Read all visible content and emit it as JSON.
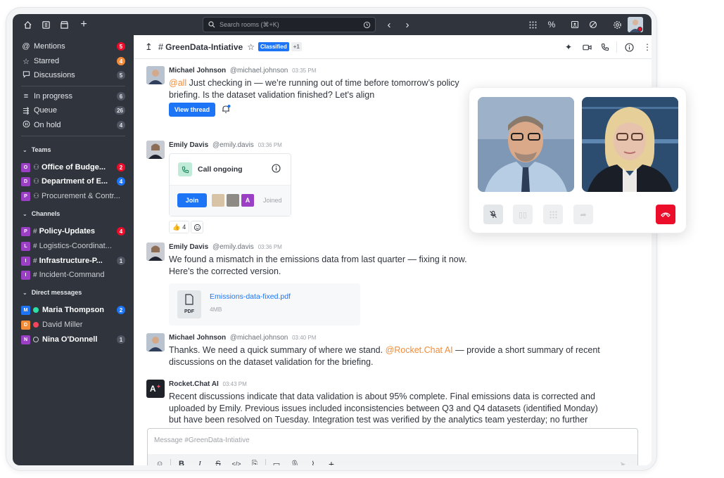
{
  "topbar": {
    "search_placeholder": "Search rooms (⌘+K)",
    "icons": [
      "home-icon",
      "directory-icon",
      "marketplace-icon",
      "plus-icon",
      "history-icon",
      "back-icon",
      "forward-icon",
      "apps-icon",
      "percent-icon",
      "contact-icon",
      "status-icon",
      "settings-icon",
      "user-avatar"
    ]
  },
  "sidebar": {
    "top": [
      {
        "label": "Mentions",
        "badge": "5",
        "badge_color": "#ec0d2a",
        "icon": "at-icon"
      },
      {
        "label": "Starred",
        "badge": "4",
        "badge_color": "#f38c39",
        "icon": "star-icon"
      },
      {
        "label": "Discussions",
        "badge": "5",
        "badge_color": "#4f5561",
        "icon": "discussion-icon"
      }
    ],
    "omni": [
      {
        "label": "In progress",
        "badge": "6",
        "icon": "progress-icon"
      },
      {
        "label": "Queue",
        "badge": "26",
        "icon": "queue-icon"
      },
      {
        "label": "On hold",
        "badge": "4",
        "icon": "pause-icon"
      }
    ],
    "teams_header": "Teams",
    "teams": [
      {
        "avatar": "O",
        "avatar_color": "#9b3fc5",
        "label": "Office of Budge...",
        "badge": "2",
        "badge_color": "#ec0d2a",
        "bold": true
      },
      {
        "avatar": "D",
        "avatar_color": "#9b3fc5",
        "label": "Department of E...",
        "badge": "4",
        "badge_color": "#1d74f5",
        "bold": true
      },
      {
        "avatar": "P",
        "avatar_color": "#9b3fc5",
        "label": "Procurement & Contr...",
        "badge": "",
        "bold": false
      }
    ],
    "channels_header": "Channels",
    "channels": [
      {
        "avatar": "P",
        "avatar_color": "#9b3fc5",
        "label": "Policy-Updates",
        "badge": "4",
        "badge_color": "#ec0d2a",
        "bold": true
      },
      {
        "avatar": "L",
        "avatar_color": "#9b3fc5",
        "label": "Logistics-Coordinat...",
        "badge": "",
        "bold": false
      },
      {
        "avatar": "I",
        "avatar_color": "#9b3fc5",
        "label": "Infrastructure-P...",
        "badge": "1",
        "badge_color": "#4f5561",
        "bold": true
      },
      {
        "avatar": "I",
        "avatar_color": "#9b3fc5",
        "label": "Incident-Command",
        "badge": "",
        "bold": false
      }
    ],
    "dm_header": "Direct messages",
    "dms": [
      {
        "avatar": "M",
        "avatar_color": "#1d74f5",
        "status_color": "#2de0a5",
        "label": "Maria Thompson",
        "badge": "2",
        "badge_color": "#1d74f5",
        "bold": true
      },
      {
        "avatar": "D",
        "avatar_color": "#f5455c",
        "status_color": "#f5455c",
        "label": "David Miller",
        "badge": "",
        "bold": false,
        "avatar_bg": "#f38c39"
      },
      {
        "avatar": "N",
        "avatar_color": "#9b3fc5",
        "status_color": "#9ea2a8",
        "label": "Nina O'Donnell",
        "badge": "1",
        "badge_color": "#4f5561",
        "bold": true
      }
    ]
  },
  "room": {
    "title": "GreenData-Intiative",
    "tag": "Classified",
    "tag_extra": "+1"
  },
  "messages": [
    {
      "name": "Michael Johnson",
      "handle": "@michael.johnson",
      "time": "03:35 PM",
      "mention": "@all",
      "text_line1": " Just checking in — we’re running out of time before tomorrow’s policy",
      "text_line2": "briefing. Is the dataset validation finished? Let's align",
      "button": "View thread"
    },
    {
      "name": "Emily Davis",
      "handle": "@emily.davis",
      "time": "03:36 PM",
      "call_title": "Call ongoing",
      "join_label": "Join",
      "joined_label": "Joined",
      "joined_avatar_letter": "A",
      "reaction_emoji": "👍",
      "reaction_count": "4"
    },
    {
      "name": "Emily Davis",
      "handle": "@emily.davis",
      "time": "03:36 PM",
      "text_line1": "We found a mismatch in the emissions data from last quarter — fixing it now.",
      "text_line2": "Here's the corrected version.",
      "file_name": "Emissions-data-fixed.pdf",
      "file_type": "PDF",
      "file_size": "4MB"
    },
    {
      "name": "Michael Johnson",
      "handle": "@michael.johnson",
      "time": "03:40 PM",
      "text_pre": "Thanks. We need a quick summary of where we stand. ",
      "mention": "@Rocket.Chat AI",
      "text_post": " — provide a short summary of recent",
      "text_line2": "discussions on the dataset validation for the briefing."
    },
    {
      "name": "Rocket.Chat AI",
      "handle": "",
      "time": "03:43 PM",
      "text_line1": "Recent discussions indicate that data validation is about 95% complete. Final emissions data is corrected and",
      "text_line2": "uploaded by Emily. Previous issues included inconsistencies between Q3 and Q4 datasets (identified Monday)",
      "text_line3": "but have been resolved on Tuesday. Integration test was verified by the analytics team yesterday; no further"
    }
  ],
  "composer": {
    "placeholder": "Message #GreenData-Intiative"
  }
}
